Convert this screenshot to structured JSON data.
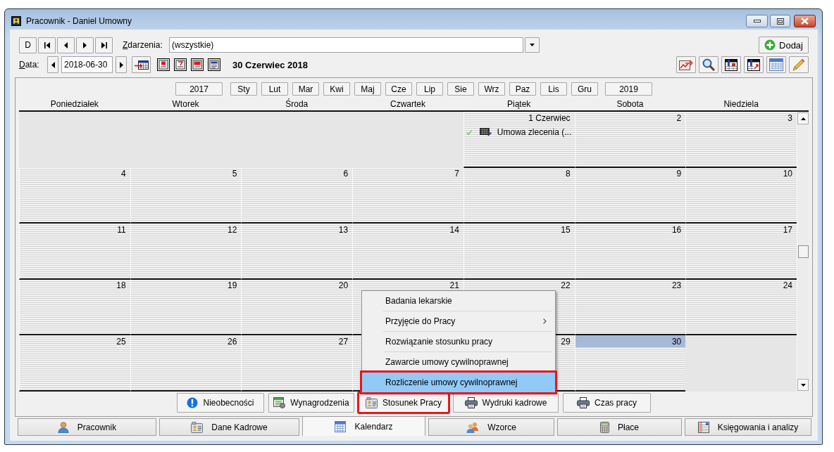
{
  "window": {
    "title": "Pracownik - Daniel Umowny"
  },
  "toolbar": {
    "nav_buttons": [
      {
        "kind": "text",
        "label": "D"
      },
      {
        "kind": "first"
      },
      {
        "kind": "previous"
      },
      {
        "kind": "next"
      },
      {
        "kind": "last"
      }
    ],
    "events_label": "Zdarzenia:",
    "events_filter": {
      "value": "(wszystkie)"
    },
    "add_button": {
      "label": "Dodaj"
    },
    "date_label": "Data:",
    "date_field": {
      "value": "2018-06-30"
    },
    "date_heading": "30 Czerwiec 2018"
  },
  "calendar": {
    "previous_year": "2017",
    "months": [
      "Sty",
      "Lut",
      "Mar",
      "Kwi",
      "Maj",
      "Cze",
      "Lip",
      "Sie",
      "Wrz",
      "Paz",
      "Lis",
      "Gru"
    ],
    "next_year": "2019",
    "weekdays": [
      "Poniedziałek",
      "Wtorek",
      "Środa",
      "Czwartek",
      "Piątek",
      "Sobota",
      "Niedziela"
    ],
    "weeks": [
      [
        {
          "kind": "outside"
        },
        {
          "kind": "outside"
        },
        {
          "kind": "outside"
        },
        {
          "kind": "outside"
        },
        {
          "kind": "day",
          "date": "1 Czerwiec",
          "selected": false,
          "events": [
            {
              "label": "Umowa zlecenia (..."
            }
          ]
        },
        {
          "kind": "day",
          "date": "2",
          "selected": false
        },
        {
          "kind": "day",
          "date": "3",
          "selected": false
        }
      ],
      [
        {
          "kind": "day",
          "date": "4",
          "selected": false
        },
        {
          "kind": "day",
          "date": "5",
          "selected": false
        },
        {
          "kind": "day",
          "date": "6",
          "selected": false
        },
        {
          "kind": "day",
          "date": "7",
          "selected": false
        },
        {
          "kind": "day",
          "date": "8",
          "selected": false
        },
        {
          "kind": "day",
          "date": "9",
          "selected": false
        },
        {
          "kind": "day",
          "date": "10",
          "selected": false
        }
      ],
      [
        {
          "kind": "day",
          "date": "11",
          "selected": false
        },
        {
          "kind": "day",
          "date": "12",
          "selected": false
        },
        {
          "kind": "day",
          "date": "13",
          "selected": false
        },
        {
          "kind": "day",
          "date": "14",
          "selected": false
        },
        {
          "kind": "day",
          "date": "15",
          "selected": false
        },
        {
          "kind": "day",
          "date": "16",
          "selected": false
        },
        {
          "kind": "day",
          "date": "17",
          "selected": false
        }
      ],
      [
        {
          "kind": "day",
          "date": "18",
          "selected": false
        },
        {
          "kind": "day",
          "date": "19",
          "selected": false
        },
        {
          "kind": "day",
          "date": "20",
          "selected": false
        },
        {
          "kind": "day",
          "date": "21",
          "selected": false
        },
        {
          "kind": "day",
          "date": "22",
          "selected": false
        },
        {
          "kind": "day",
          "date": "23",
          "selected": false
        },
        {
          "kind": "day",
          "date": "24",
          "selected": false
        }
      ],
      [
        {
          "kind": "day",
          "date": "25",
          "selected": false
        },
        {
          "kind": "day",
          "date": "26",
          "selected": false
        },
        {
          "kind": "day",
          "date": "27",
          "selected": false
        },
        {
          "kind": "day",
          "selected": false
        },
        {
          "kind": "day",
          "date": "29",
          "selected": false
        },
        {
          "kind": "day",
          "date": "30",
          "selected": true
        },
        {
          "kind": "outside"
        }
      ]
    ]
  },
  "context_menu": {
    "items": [
      {
        "label": "Badania lekarskie",
        "submenu": false,
        "selected": false,
        "outlined": false
      },
      {
        "label": "Przyjęcie do Pracy",
        "submenu": true,
        "selected": false,
        "outlined": false
      },
      {
        "label": "Rozwiązanie stosunku pracy",
        "submenu": false,
        "selected": false,
        "outlined": false
      },
      {
        "label": "Zawarcie umowy cywilnoprawnej",
        "submenu": false,
        "selected": false,
        "outlined": false
      },
      {
        "label": "Rozliczenie umowy cywilnoprawnej",
        "submenu": false,
        "selected": true,
        "outlined": true
      }
    ]
  },
  "actions": [
    {
      "label": "Nieobecności",
      "outlined": false
    },
    {
      "label": "Wynagrodzenia",
      "outlined": false
    },
    {
      "label": "Stosunek Pracy",
      "outlined": true
    },
    {
      "label": "Wydruki kadrowe",
      "outlined": false
    },
    {
      "label": "Czas pracy",
      "outlined": false
    }
  ],
  "tabs": [
    {
      "label": "Pracownik",
      "selected": false
    },
    {
      "label": "Dane Kadrowe",
      "selected": false
    },
    {
      "label": "Kalendarz",
      "selected": true
    },
    {
      "label": "Wzorce",
      "selected": false
    },
    {
      "label": "Płace",
      "selected": false
    },
    {
      "label": "Księgowania i analizy",
      "selected": false
    }
  ]
}
